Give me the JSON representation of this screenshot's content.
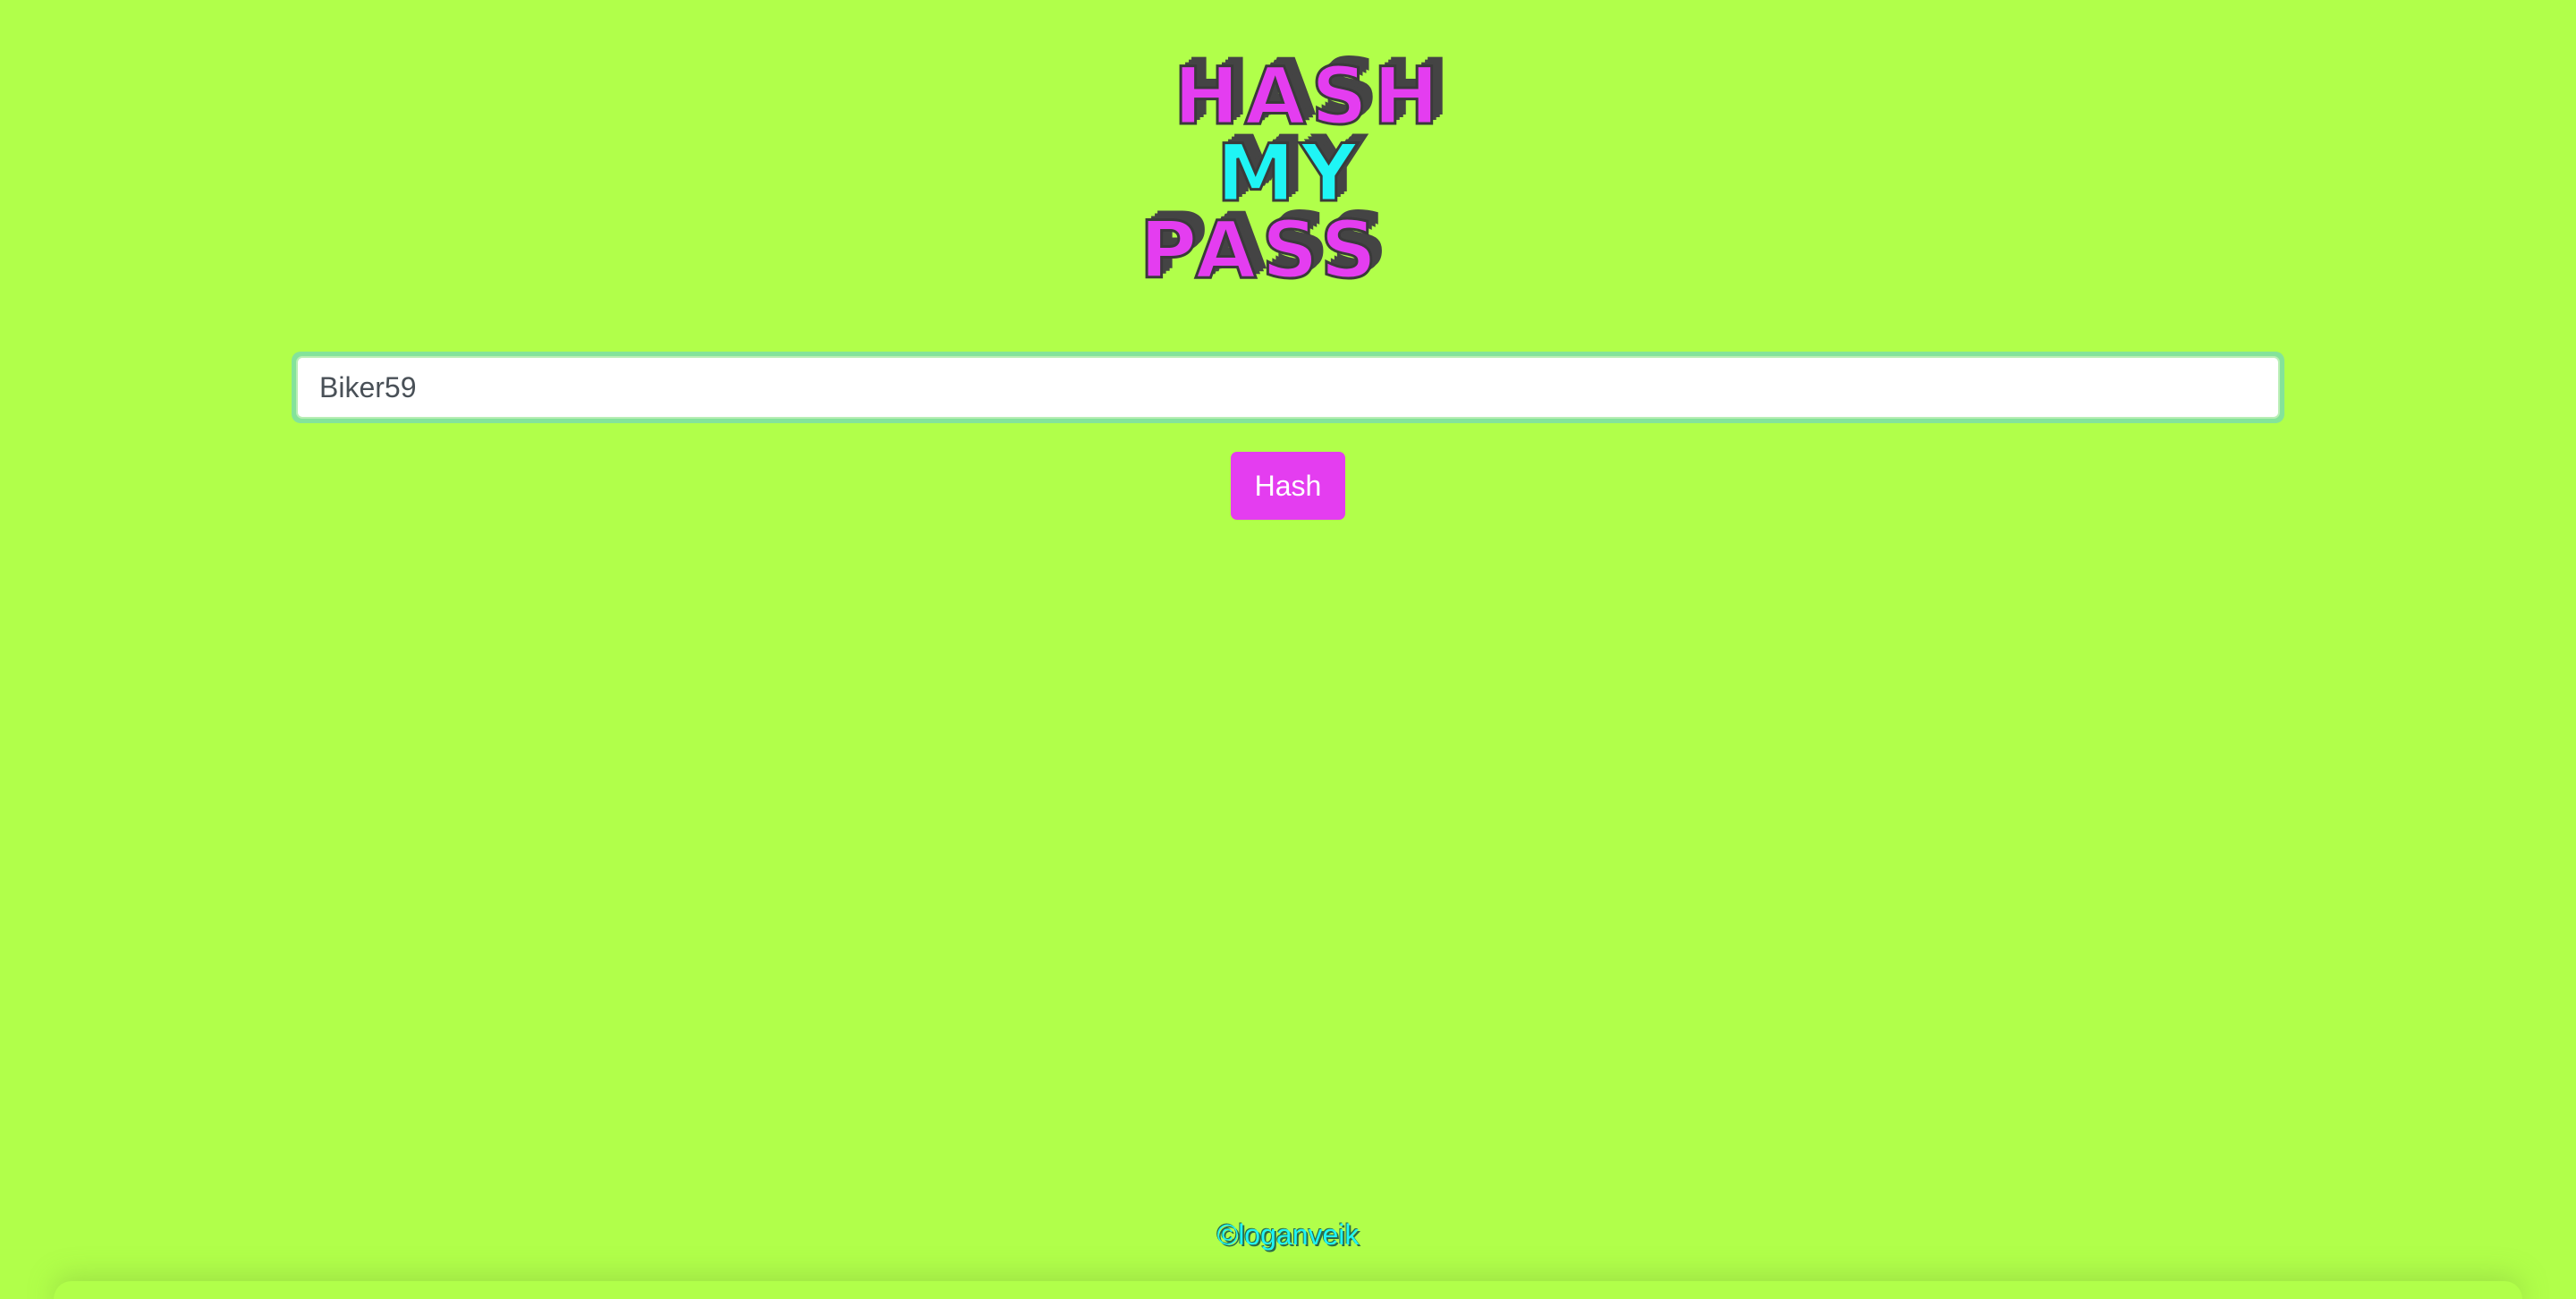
{
  "logo": {
    "line1": "HASH",
    "line2": "MY",
    "line3": "PASS"
  },
  "password_input": {
    "value": "Biker59",
    "placeholder": ""
  },
  "hash_button": {
    "label": "Hash"
  },
  "footer": {
    "credit": "©loganveik"
  },
  "colors": {
    "background": "#b1ff4a",
    "primary_magenta": "#e43df0",
    "accent_cyan": "#1ff5f5",
    "logo_shadow": "#444444",
    "input_focus_ring": "#84e39a"
  }
}
